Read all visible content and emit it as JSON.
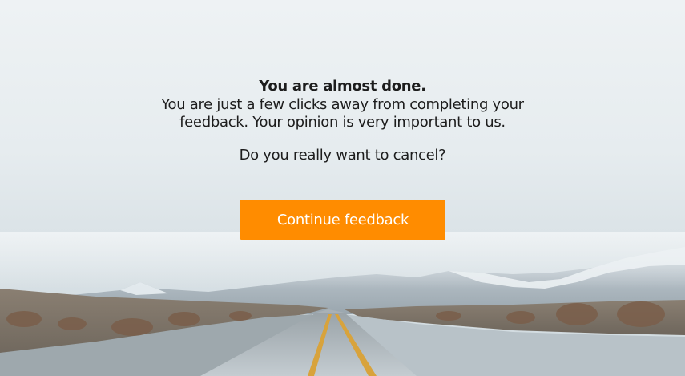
{
  "dialog": {
    "title": "You are almost done.",
    "message": "You are just a few clicks away from completing your feedback. Your opinion is very important to us.",
    "question": "Do you really want to cancel?",
    "continue_label": "Continue feedback"
  },
  "colors": {
    "accent": "#ff8c00",
    "button_text": "#ffffff",
    "text": "#1d1d1d"
  }
}
